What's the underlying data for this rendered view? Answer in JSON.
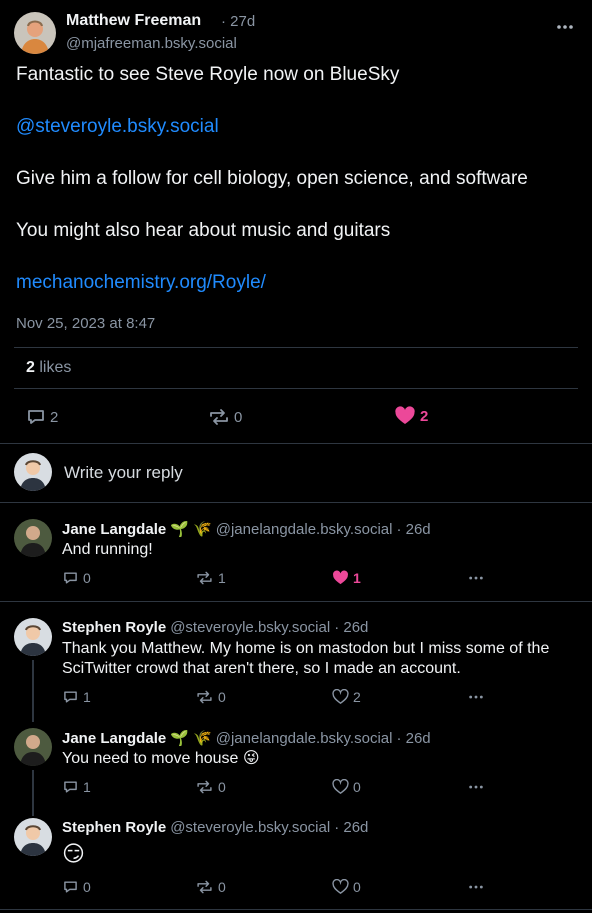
{
  "main_post": {
    "author_name": "Matthew Freeman",
    "time_ago": "· 27d",
    "handle": "@mjafreeman.bsky.social",
    "lines": [
      {
        "text": "Fantastic to see Steve Royle now on BlueSky",
        "is_link": false
      },
      {
        "text": "@steveroyle.bsky.social",
        "is_link": true
      },
      {
        "text": "Give him a follow for cell biology, open science, and software",
        "is_link": false
      },
      {
        "text": "You might also hear about music and guitars",
        "is_link": false
      },
      {
        "text": "mechanochemistry.org/Royle/",
        "is_link": true
      }
    ],
    "date": "Nov 25, 2023 at 8:47",
    "likes_count": "2",
    "likes_label": "likes",
    "replies": "2",
    "reposts": "0",
    "likes": "2"
  },
  "composer": {
    "placeholder": "Write your reply"
  },
  "replies": [
    {
      "name": "Jane Langdale",
      "emojis": "🌱 🌾",
      "handle": "@janelangdale.bsky.social",
      "time": "· 26d",
      "text": "And running!",
      "replies": "0",
      "reposts": "1",
      "likes": "1"
    },
    {
      "name": "Stephen Royle",
      "handle": "@steveroyle.bsky.social",
      "time": "· 26d",
      "text_lines": [
        "Thank you Matthew. My home is on mastodon but I miss some of the",
        "SciTwitter crowd that aren't there, so I made an account."
      ],
      "replies": "1",
      "reposts": "0",
      "likes": "2"
    },
    {
      "name": "Jane Langdale",
      "emojis": "🌱 🌾",
      "handle": "@janelangdale.bsky.social",
      "time": "· 26d",
      "text": "You need to move house 😜",
      "replies": "1",
      "reposts": "0",
      "likes": "0"
    },
    {
      "name": "Stephen Royle",
      "handle": "@steveroyle.bsky.social",
      "time": "· 26d",
      "text": "😏",
      "replies": "0",
      "reposts": "0",
      "likes": "0"
    }
  ],
  "colors": {
    "background": "#000000",
    "link": "#208bfe",
    "like_active": "#ec4899",
    "muted": "#8a95a3",
    "divider": "#2e3640"
  },
  "icons": [
    "reply-icon",
    "repost-icon",
    "heart-icon",
    "more-icon",
    "avatar"
  ]
}
